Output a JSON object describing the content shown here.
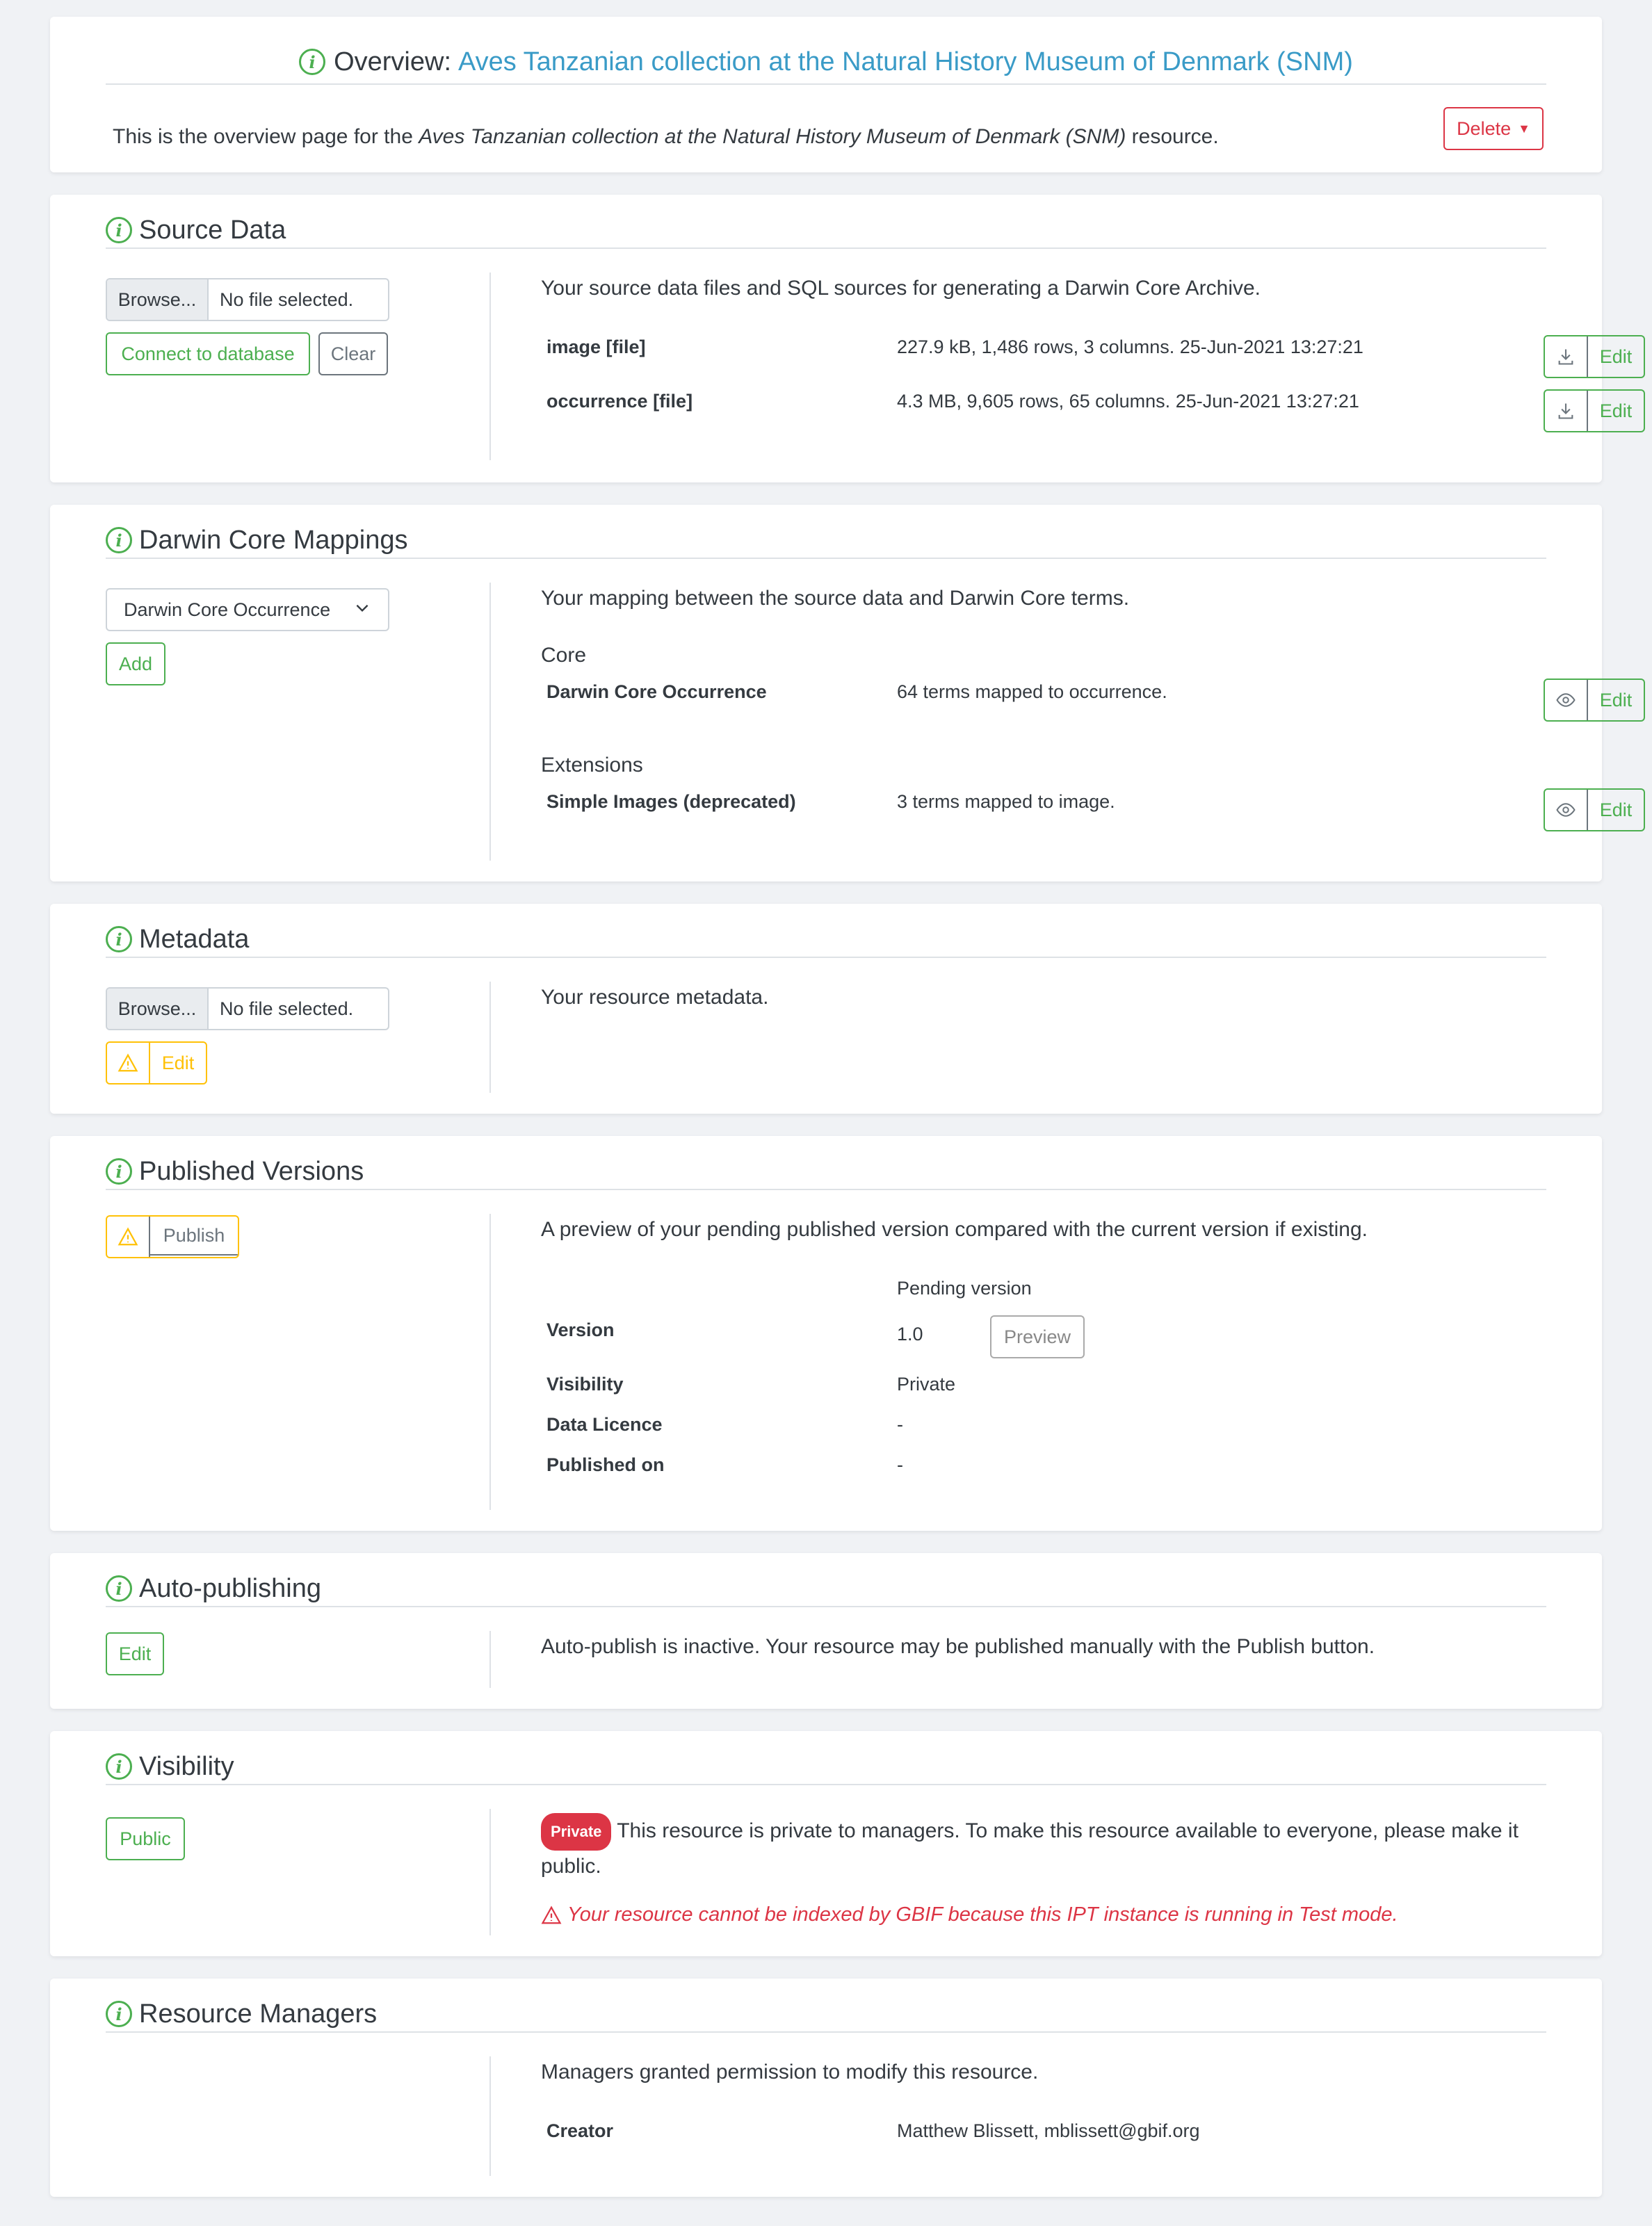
{
  "overview": {
    "prefix": "Overview:",
    "resource_name": "Aves Tanzanian collection at the Natural History Museum of Denmark (SNM)",
    "desc_before": "This is the overview page for the ",
    "desc_after": " resource.",
    "delete_label": "Delete"
  },
  "source_data": {
    "title": "Source Data",
    "browse_label": "Browse...",
    "no_file_label": "No file selected.",
    "connect_label": "Connect to database",
    "clear_label": "Clear",
    "description": "Your source data files and SQL sources for generating a Darwin Core Archive.",
    "files": [
      {
        "name": "image [file]",
        "info": "227.9 kB, 1,486 rows, 3 columns. 25-Jun-2021 13:27:21",
        "edit_label": "Edit"
      },
      {
        "name": "occurrence [file]",
        "info": "4.3 MB, 9,605 rows, 65 columns. 25-Jun-2021 13:27:21",
        "edit_label": "Edit"
      }
    ]
  },
  "mappings": {
    "title": "Darwin Core Mappings",
    "select_value": "Darwin Core Occurrence",
    "add_label": "Add",
    "description": "Your mapping between the source data and Darwin Core terms.",
    "core_heading": "Core",
    "core": {
      "name": "Darwin Core Occurrence",
      "info": "64 terms mapped to occurrence.",
      "edit_label": "Edit"
    },
    "extensions_heading": "Extensions",
    "extension": {
      "name": "Simple Images (deprecated)",
      "info": "3 terms mapped to image.",
      "edit_label": "Edit"
    }
  },
  "metadata": {
    "title": "Metadata",
    "browse_label": "Browse...",
    "no_file_label": "No file selected.",
    "edit_label": "Edit",
    "description": "Your resource metadata."
  },
  "published": {
    "title": "Published Versions",
    "publish_label": "Publish",
    "description": "A preview of your pending published version compared with the current version if existing.",
    "pending_heading": "Pending version",
    "rows": {
      "version_label": "Version",
      "version_value": "1.0",
      "visibility_label": "Visibility",
      "visibility_value": "Private",
      "licence_label": "Data Licence",
      "licence_value": "-",
      "published_label": "Published on",
      "published_value": "-"
    },
    "preview_label": "Preview"
  },
  "autopublish": {
    "title": "Auto-publishing",
    "edit_label": "Edit",
    "description": "Auto-publish is inactive. Your resource may be published manually with the Publish button."
  },
  "visibility": {
    "title": "Visibility",
    "public_label": "Public",
    "badge": "Private",
    "description": "This resource is private to managers. To make this resource available to everyone, please make it public.",
    "warning": "Your resource cannot be indexed by GBIF because this IPT instance is running in Test mode."
  },
  "managers": {
    "title": "Resource Managers",
    "description": "Managers granted permission to modify this resource.",
    "creator_label": "Creator",
    "creator_value": "Matthew Blissett, mblissett@gbif.org"
  },
  "colors": {
    "accent_green": "#4caf50",
    "link_blue": "#3a9bc7",
    "danger": "#dc3545",
    "warning": "#ffc107"
  }
}
